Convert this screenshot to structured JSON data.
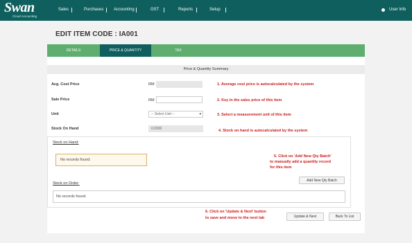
{
  "app": {
    "logo_text": "Swan",
    "logo_subtext": "Cloud Accounting",
    "nav": [
      "Sales",
      "Purchases",
      "Accounting",
      "GST",
      "Reports",
      "Setup"
    ],
    "user_info": "User Info",
    "user_icon": "gear-icon"
  },
  "page": {
    "title": "EDIT ITEM CODE : IA001",
    "tabs": [
      "DETAILS",
      "PRICE & QUANTITY",
      "TAX"
    ],
    "active_tab": "PRICE & QUANTITY"
  },
  "summary": {
    "header": "Price & Quantity Summary",
    "avg_cost_label": "Avg. Cost Price",
    "avg_cost_currency": "RM",
    "avg_cost_value": "",
    "sale_price_label": "Sale Price",
    "sale_price_currency": "RM",
    "sale_price_value": "",
    "unit_label": "Unit",
    "unit_value": "-- Select Unit --",
    "stock_on_hand_label": "Stock On Hand",
    "stock_on_hand_value": "0.0000"
  },
  "notes": {
    "n1": "1. Average cost price is autocalculated by the system",
    "n2": "2. Key in the sales price of this item",
    "n3": "3. Select a measurement unit of this item",
    "n4": "4. Stock on hand is autocalculated by the system",
    "n5_line1": "5. Click on 'Add New Qty Batch'",
    "n5_line2": "to manually add a quantity record",
    "n5_line3": "for this item",
    "n6_line1": "6. Click on 'Update & Next' button",
    "n6_line2": "to save and move to the next tab"
  },
  "stock": {
    "on_hand_title": "Stock on Hand:",
    "on_hand_empty": "No records found.",
    "add_batch_button": "Add New Qty Batch",
    "on_order_title": "Stock on Order:",
    "on_order_empty": "No records found."
  },
  "actions": {
    "update_next": "Update & Next",
    "back_to_list": "Back To List"
  },
  "colors": {
    "topbar": "#0e5f5d",
    "tabs": "#5fae6f",
    "active_tab": "#0e5f5d",
    "annotation": "#cc1a1a"
  }
}
